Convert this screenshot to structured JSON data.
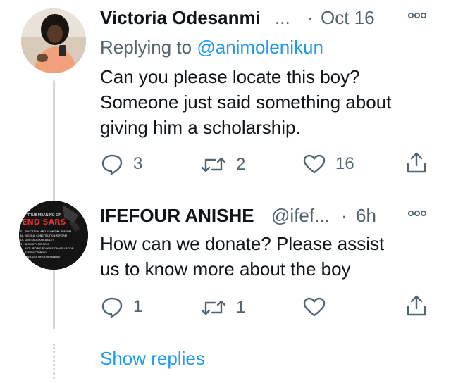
{
  "tweets": [
    {
      "author_name": "Victoria Odesanmi",
      "handle": "...",
      "separator": "·",
      "time": "Oct 16",
      "replying_label": "Replying to",
      "replying_handle": "@animolenikun",
      "text_lines": [
        "Can you please locate this boy?",
        "Someone just said something about",
        "giving him a scholarship."
      ],
      "replies": "3",
      "retweets": "2",
      "likes": "16",
      "avatar_icon": "profile-photo",
      "colors": {
        "avatar_bg": "#c9b8a6",
        "shirt": "#f2a27a"
      }
    },
    {
      "author_name": "IFEFOUR ANISHE",
      "handle": "@ifef...",
      "separator": "·",
      "time": "6h",
      "text_lines": [
        "How can we donate? Please assist",
        "us to know more about the boy"
      ],
      "replies": "1",
      "retweets": "1",
      "likes": "",
      "avatar_icon": "end-sars-poster",
      "avatar_text": {
        "title": "TRUE MEANING OF",
        "headline": "END SARS",
        "items": [
          "E - EDUCATION AND ECONOMY REFORM",
          "N - NIGERIA CONSTITUTION REFORM",
          "D - DEBT ACCOUNTABILITY",
          "S - SECURITY REFORM",
          "A - ANTI-PEOPLE POLICIES CANCELLATION",
          "R - RESTRUCTURING",
          "S - THE COST OF GOVERNANCE"
        ]
      }
    }
  ],
  "show_replies": "Show replies",
  "colors": {
    "accent": "#1d9bf0",
    "secondary": "#536471",
    "line": "#cfd9de"
  }
}
